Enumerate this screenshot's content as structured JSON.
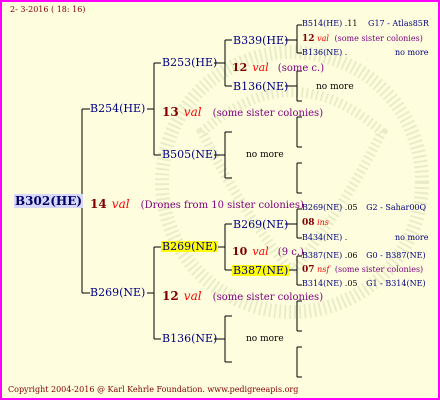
{
  "header": {
    "date": "2-  3-2016 ( 18: 16)"
  },
  "footer": {
    "copyright": "Copyright 2004-2016 @ Karl Kehrle Foundation.   www.pedigreeapis.org"
  },
  "colors": {
    "border": "#ff00ff",
    "background": "#fefedf",
    "highlight": "#ffff00"
  },
  "root": {
    "id": "B302(HE)"
  },
  "gen1": {
    "top": {
      "id": "B254(HE)"
    },
    "bottom": {
      "id": "B269(NE)"
    },
    "mate": {
      "num": "14",
      "mark": "val",
      "desc": "(Drones from 10 sister colonies)"
    }
  },
  "gen2": {
    "a": {
      "id": "B253(HE)"
    },
    "b": {
      "id": "B505(NE)",
      "nomore": "no more"
    },
    "c": {
      "id": "B269(NE)"
    },
    "d": {
      "id": "B136(NE)",
      "nomore": "no more"
    },
    "mate_top": {
      "num": "13",
      "mark": "val",
      "desc": "(some sister colonies)"
    },
    "mate_bottom": {
      "num": "12",
      "mark": "val",
      "desc": "(some sister colonies)"
    }
  },
  "gen3": {
    "a1": {
      "id": "B339(HE)"
    },
    "a2": {
      "id": "B136(NE)",
      "nomore": "no more"
    },
    "a_mate": {
      "num": "12",
      "mark": "val",
      "desc": "(some c.)"
    },
    "c1": {
      "id": "B269(NE)"
    },
    "c2": {
      "id": "B387(NE)"
    },
    "c_mate": {
      "num": "10",
      "mark": "val",
      "desc": "(9 c.)"
    }
  },
  "gen4": {
    "r1": {
      "id": "B514(HE)",
      "score": ".11",
      "ref": "G17 - Atlas85R"
    },
    "r1_mate": {
      "num": "12",
      "mark": "val",
      "desc": "(some sister colonies)"
    },
    "r2": {
      "id": "B136(NE)",
      "score": ".",
      "ref": "no more"
    },
    "r3": {
      "id": "B269(NE)",
      "score": ".05",
      "ref": "G2 - Sahar00Q"
    },
    "r3_mate": {
      "num": "08",
      "mark": "ins"
    },
    "r4": {
      "id": "B434(NE)",
      "score": ".",
      "ref": "no more"
    },
    "r5": {
      "id": "B387(NE)",
      "score": ".06",
      "ref": "G0 - B387(NE)"
    },
    "r5_mate": {
      "num": "07",
      "mark": "nsf",
      "desc": "(some sister colonies)"
    },
    "r6": {
      "id": "B314(NE)",
      "score": ".05",
      "ref": "G1 - B314(NE)"
    }
  }
}
